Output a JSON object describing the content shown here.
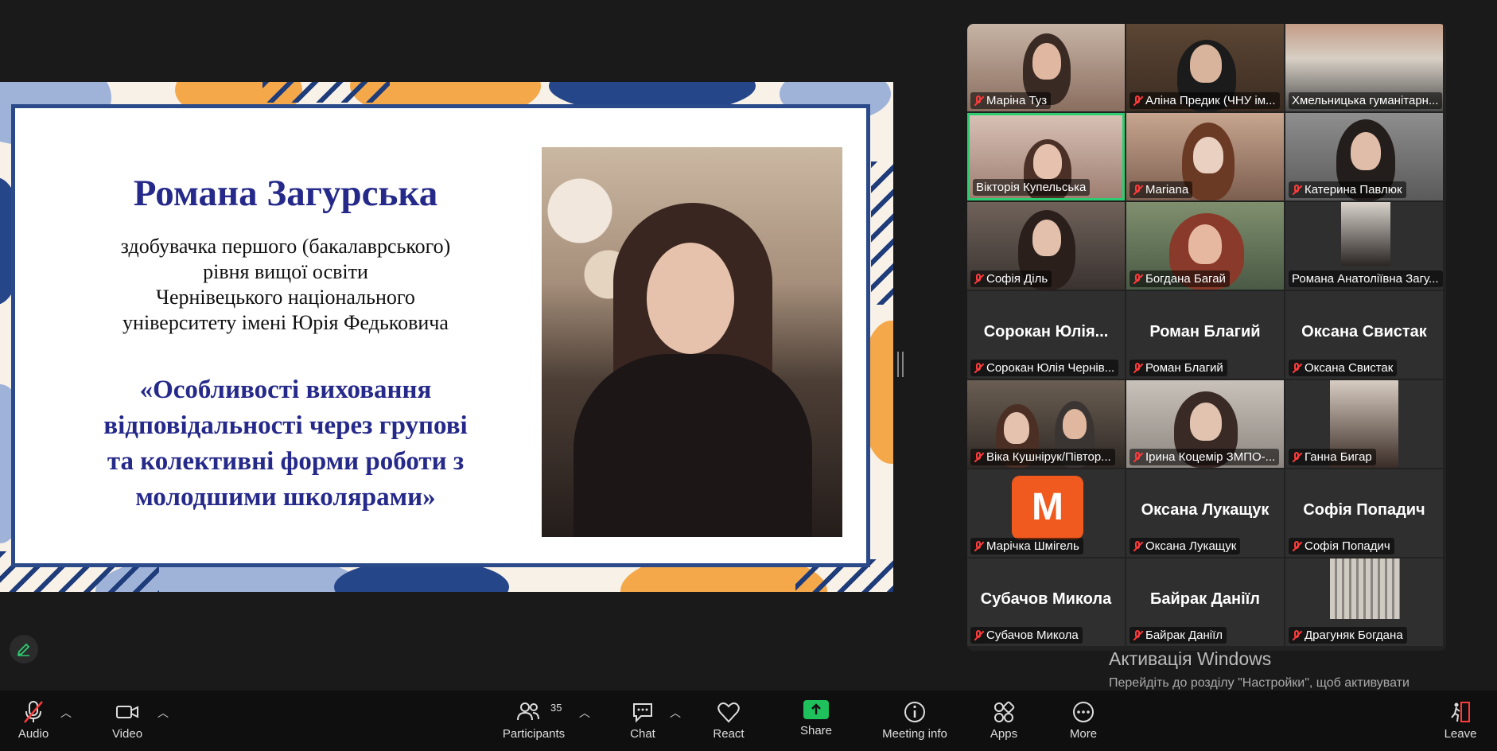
{
  "slide": {
    "name": "Романа Загурська",
    "subtitle_lines": [
      "здобувачка першого (бакалаврського)",
      "рівня вищої освіти",
      "Чернівецького національного",
      "університету імені Юрія Федьковича"
    ],
    "topic_lines": [
      "«Особливості виховання",
      "відповідальності через групові",
      "та колективні форми роботи з",
      "молодшими школярами»"
    ]
  },
  "gallery": {
    "tiles": [
      {
        "label": "Маріна Туз"
      },
      {
        "label": "Аліна Предик (ЧНУ ім..."
      },
      {
        "label": "Хмельницька гуманітарн..."
      },
      {
        "label": "Вікторія Купельська",
        "active": true
      },
      {
        "label": "Mariana"
      },
      {
        "label": "Катерина Павлюк"
      },
      {
        "label": "Софія Діль"
      },
      {
        "label": "Богдана Багай"
      },
      {
        "label": "Романа Анатоліївна Загу..."
      },
      {
        "label": "Сорокан Юлія Чернів...",
        "center": "Сорокан Юлія..."
      },
      {
        "label": "Роман Благий",
        "center": "Роман Благий"
      },
      {
        "label": "Оксана Свистак",
        "center": "Оксана Свистак"
      },
      {
        "label": "Віка Кушнірук/Півтор..."
      },
      {
        "label": "Ірина Коцемір ЗМПО-..."
      },
      {
        "label": "Ганна Бигар"
      },
      {
        "label": "Марічка Шмігель",
        "avatar": "M"
      },
      {
        "label": "Оксана Лукащук",
        "center": "Оксана Лукащук"
      },
      {
        "label": "Софія Попадич",
        "center": "Софія Попадич"
      },
      {
        "label": "Субачов Микола",
        "center": "Субачов Микола"
      },
      {
        "label": "Байрак Даніїл",
        "center": "Байрак Даніїл"
      },
      {
        "label": "Драгуняк Богдана"
      }
    ]
  },
  "watermark": {
    "title": "Активація Windows",
    "text": "Перейдіть до розділу \"Настройки\", щоб активувати Windows."
  },
  "toolbar": {
    "audio": "Audio",
    "video": "Video",
    "participants": "Participants",
    "participants_count": "35",
    "chat": "Chat",
    "react": "React",
    "share": "Share",
    "meeting_info": "Meeting info",
    "apps": "Apps",
    "more": "More",
    "leave": "Leave"
  },
  "colors": {
    "accent_green": "#1fc15c",
    "slide_title": "#25298a",
    "mute_red": "#ff3b3b",
    "avatar_orange": "#f05a1e"
  }
}
